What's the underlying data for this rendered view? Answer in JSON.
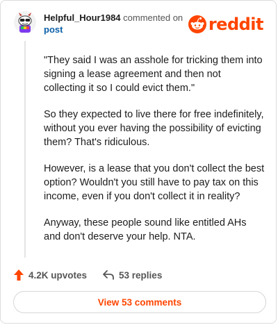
{
  "header": {
    "username": "Helpful_Hour1984",
    "commented_on": "commented on",
    "post_link": "post",
    "logo_text": "reddit"
  },
  "comment": {
    "paragraphs": [
      "\"They said I was an asshole for tricking them into signing a lease agreement and then not collecting it so I could evict them.\"",
      "So they expected to live there for free indefinitely, without you ever having the possibility of evicting them? That's ridiculous.",
      "However, is a lease that you don't collect the best option? Wouldn't you still have to pay tax on this income, even if you don't collect it in reality?",
      "Anyway, these people sound like entitled AHs and don't deserve your help. NTA."
    ]
  },
  "actions": {
    "upvotes_label": "4.2K upvotes",
    "replies_label": "53 replies"
  },
  "footer": {
    "view_comments_label": "View 53 comments"
  },
  "colors": {
    "brand": "#ff4500",
    "link": "#0b5fa8"
  }
}
